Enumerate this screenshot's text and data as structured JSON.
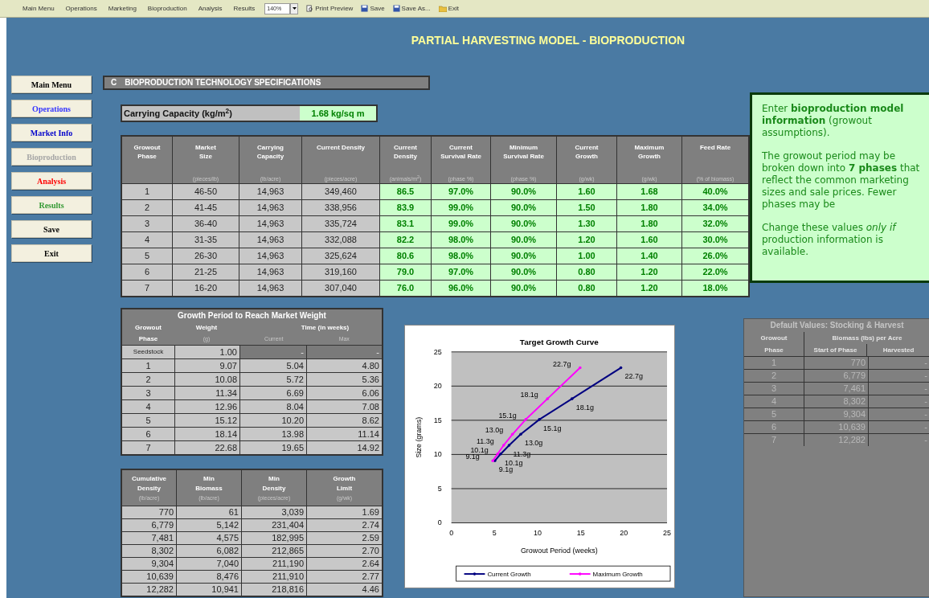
{
  "toolbar": {
    "items": [
      {
        "kind": "text",
        "label": "Main Menu"
      },
      {
        "kind": "text",
        "label": "Operations"
      },
      {
        "kind": "text",
        "label": "Marketing"
      },
      {
        "kind": "text",
        "label": "Bioproduction"
      },
      {
        "kind": "text",
        "label": "Analysis"
      },
      {
        "kind": "text",
        "label": "Results"
      },
      {
        "kind": "zoom",
        "label": "140%"
      },
      {
        "kind": "preview",
        "label": "Print Preview"
      },
      {
        "kind": "save",
        "label": "Save"
      },
      {
        "kind": "save",
        "label": "Save As..."
      },
      {
        "kind": "exit",
        "label": "Exit"
      }
    ]
  },
  "title": "PARTIAL HARVESTING MODEL - BIOPRODUCTION",
  "nav": [
    {
      "label": "Main Menu",
      "color": "#000000"
    },
    {
      "label": "Operations",
      "color": "#3333ff"
    },
    {
      "label": "Market Info",
      "color": "#0000cc"
    },
    {
      "label": "Bioproduction",
      "color": "#a6a6a6"
    },
    {
      "label": "Analysis",
      "color": "#ff0000"
    },
    {
      "label": "Results",
      "color": "#339933"
    },
    {
      "label": "Save",
      "color": "#000000"
    },
    {
      "label": "Exit",
      "color": "#000000"
    }
  ],
  "section": {
    "letter": "C",
    "title": "BIOPRODUCTION TECHNOLOGY SPECIFICATIONS"
  },
  "carrying_capacity": {
    "label": "Carrying Capacity (kg/m$^{2}$)",
    "value": "1.68 kg/sq m"
  },
  "spec_table": {
    "columns": [
      {
        "label": "Growout\nPhase",
        "kind": "calc"
      },
      {
        "label": "Market\nSize",
        "unit": "(pieces/lb)",
        "kind": "calc"
      },
      {
        "label": "Carrying\nCapacity",
        "unit": "(lb/acre)",
        "kind": "calc"
      },
      {
        "label": "Current Density",
        "unit": "(pieces/acre)",
        "kind": "calc"
      },
      {
        "label": "Current\nDensity",
        "unit": "(animals/m$^{2}$)",
        "kind": "input"
      },
      {
        "label": "Current\nSurvival Rate",
        "unit": "(phase %)",
        "kind": "input"
      },
      {
        "label": "Minimum\nSurvival Rate",
        "unit": "(phase %)",
        "kind": "input"
      },
      {
        "label": "Current\nGrowth",
        "unit": "(g/wk)",
        "kind": "input"
      },
      {
        "label": "Maximum\nGrowth",
        "unit": "(g/wk)",
        "kind": "input"
      },
      {
        "label": "Feed Rate",
        "unit": "(% of biomass)",
        "kind": "input"
      }
    ],
    "rows": [
      [
        "1",
        "46-50",
        "14,963",
        "349,460",
        "86.5",
        "97.0%",
        "90.0%",
        "1.60",
        "1.68",
        "40.0%"
      ],
      [
        "2",
        "41-45",
        "14,963",
        "338,956",
        "83.9",
        "99.0%",
        "90.0%",
        "1.50",
        "1.80",
        "34.0%"
      ],
      [
        "3",
        "36-40",
        "14,963",
        "335,724",
        "83.1",
        "99.0%",
        "90.0%",
        "1.30",
        "1.80",
        "32.0%"
      ],
      [
        "4",
        "31-35",
        "14,963",
        "332,088",
        "82.2",
        "98.0%",
        "90.0%",
        "1.20",
        "1.60",
        "30.0%"
      ],
      [
        "5",
        "26-30",
        "14,963",
        "325,624",
        "80.6",
        "98.0%",
        "90.0%",
        "1.00",
        "1.40",
        "26.0%"
      ],
      [
        "6",
        "21-25",
        "14,963",
        "319,160",
        "79.0",
        "97.0%",
        "90.0%",
        "0.80",
        "1.20",
        "22.0%"
      ],
      [
        "7",
        "16-20",
        "14,963",
        "307,040",
        "76.0",
        "96.0%",
        "90.0%",
        "0.80",
        "1.20",
        "18.0%"
      ]
    ]
  },
  "note": {
    "paragraphs": [
      "Enter **bioproduction model information** (growout assumptions).",
      "The growout period may be broken down into **7 phases** that reflect the common marketing sizes and sale prices.  Fewer phases may be",
      "Change these values *only if* production information is available."
    ]
  },
  "growth_table": {
    "title": "Growth Period to Reach Market Weight",
    "phase_header": "Growout\nPhase",
    "weight_header": "Weight",
    "weight_unit": "(g)",
    "time_header": "Time (in weeks)",
    "time_columns": [
      "Current",
      "Max"
    ],
    "rows": [
      {
        "kind": "seed",
        "cells": [
          "Seedstock",
          "1.00",
          "-",
          "-"
        ]
      },
      {
        "kind": "phase",
        "cells": [
          "1",
          "9.07",
          "5.04",
          "4.80"
        ]
      },
      {
        "kind": "phase",
        "cells": [
          "2",
          "10.08",
          "5.72",
          "5.36"
        ]
      },
      {
        "kind": "phase",
        "cells": [
          "3",
          "11.34",
          "6.69",
          "6.06"
        ]
      },
      {
        "kind": "phase",
        "cells": [
          "4",
          "12.96",
          "8.04",
          "7.08"
        ]
      },
      {
        "kind": "phase",
        "cells": [
          "5",
          "15.12",
          "10.20",
          "8.62"
        ]
      },
      {
        "kind": "phase",
        "cells": [
          "6",
          "18.14",
          "13.98",
          "11.14"
        ]
      },
      {
        "kind": "phase",
        "cells": [
          "7",
          "22.68",
          "19.65",
          "14.92"
        ]
      }
    ]
  },
  "limit_table": {
    "columns": [
      {
        "label": "Cumulative\nDensity",
        "unit": "(lb/acre)"
      },
      {
        "label": "Min\nBiomass",
        "unit": "(lb/acre)"
      },
      {
        "label": "Min\nDensity",
        "unit": "(pieces/acre)"
      },
      {
        "label": "Growth\nLimit",
        "unit": "(g/wk)"
      }
    ],
    "rows": [
      [
        "770",
        "61",
        "3,039",
        "1.69"
      ],
      [
        "6,779",
        "5,142",
        "231,404",
        "2.74"
      ],
      [
        "7,481",
        "4,575",
        "182,995",
        "2.59"
      ],
      [
        "8,302",
        "6,082",
        "212,865",
        "2.70"
      ],
      [
        "9,304",
        "7,040",
        "211,190",
        "2.64"
      ],
      [
        "10,639",
        "8,476",
        "211,910",
        "2.77"
      ],
      [
        "12,282",
        "10,941",
        "218,816",
        "4.46"
      ]
    ]
  },
  "growth_chart": {
    "chart_data": {
      "type": "line",
      "title": "Target Growth Curve",
      "xlabel": "Growout Period (weeks)",
      "ylabel": "Size (grams)",
      "xlim": [
        0,
        25
      ],
      "ylim": [
        0,
        25
      ],
      "xticks": [
        0,
        5,
        10,
        15,
        20,
        25
      ],
      "yticks": [
        0,
        5,
        10,
        15,
        20,
        25
      ],
      "data_labels": true,
      "grid": "major",
      "legend": "bottom",
      "series": [
        {
          "name": "Current Growth",
          "color": "#000080",
          "x": [
            5.04,
            5.72,
            6.69,
            8.04,
            10.2,
            13.98,
            19.65
          ],
          "values": [
            9.07,
            10.08,
            11.34,
            12.96,
            15.12,
            18.14,
            22.68
          ],
          "value_labels": [
            "9.1g",
            "10.1g",
            "11.3g",
            "13.0g",
            "15.1g",
            "18.1g",
            "22.7g"
          ]
        },
        {
          "name": "Maximum Growth",
          "color": "#ff00ff",
          "x": [
            4.8,
            5.36,
            6.06,
            7.08,
            8.62,
            11.14,
            14.92
          ],
          "values": [
            9.07,
            10.08,
            11.34,
            12.96,
            15.12,
            18.14,
            22.68
          ],
          "value_labels": [
            "9.1g",
            "10.1g",
            "11.3g",
            "13.0g",
            "15.1g",
            "18.1g",
            "22.7g"
          ]
        }
      ]
    }
  },
  "defaults_table": {
    "title": "Default Values: Stocking & Harvest",
    "phase_header": "Growout\nPhase",
    "group_header": "Biomass (lbs) per Acre",
    "columns": [
      "Start of Phase",
      "Harvested"
    ],
    "rows": [
      [
        "1",
        "770",
        "-"
      ],
      [
        "2",
        "6,779",
        "-"
      ],
      [
        "3",
        "7,461",
        "-"
      ],
      [
        "4",
        "8,302",
        "-"
      ],
      [
        "5",
        "9,304",
        "-"
      ],
      [
        "6",
        "10,639",
        "-"
      ],
      [
        "7",
        "12,282",
        "-"
      ]
    ]
  }
}
